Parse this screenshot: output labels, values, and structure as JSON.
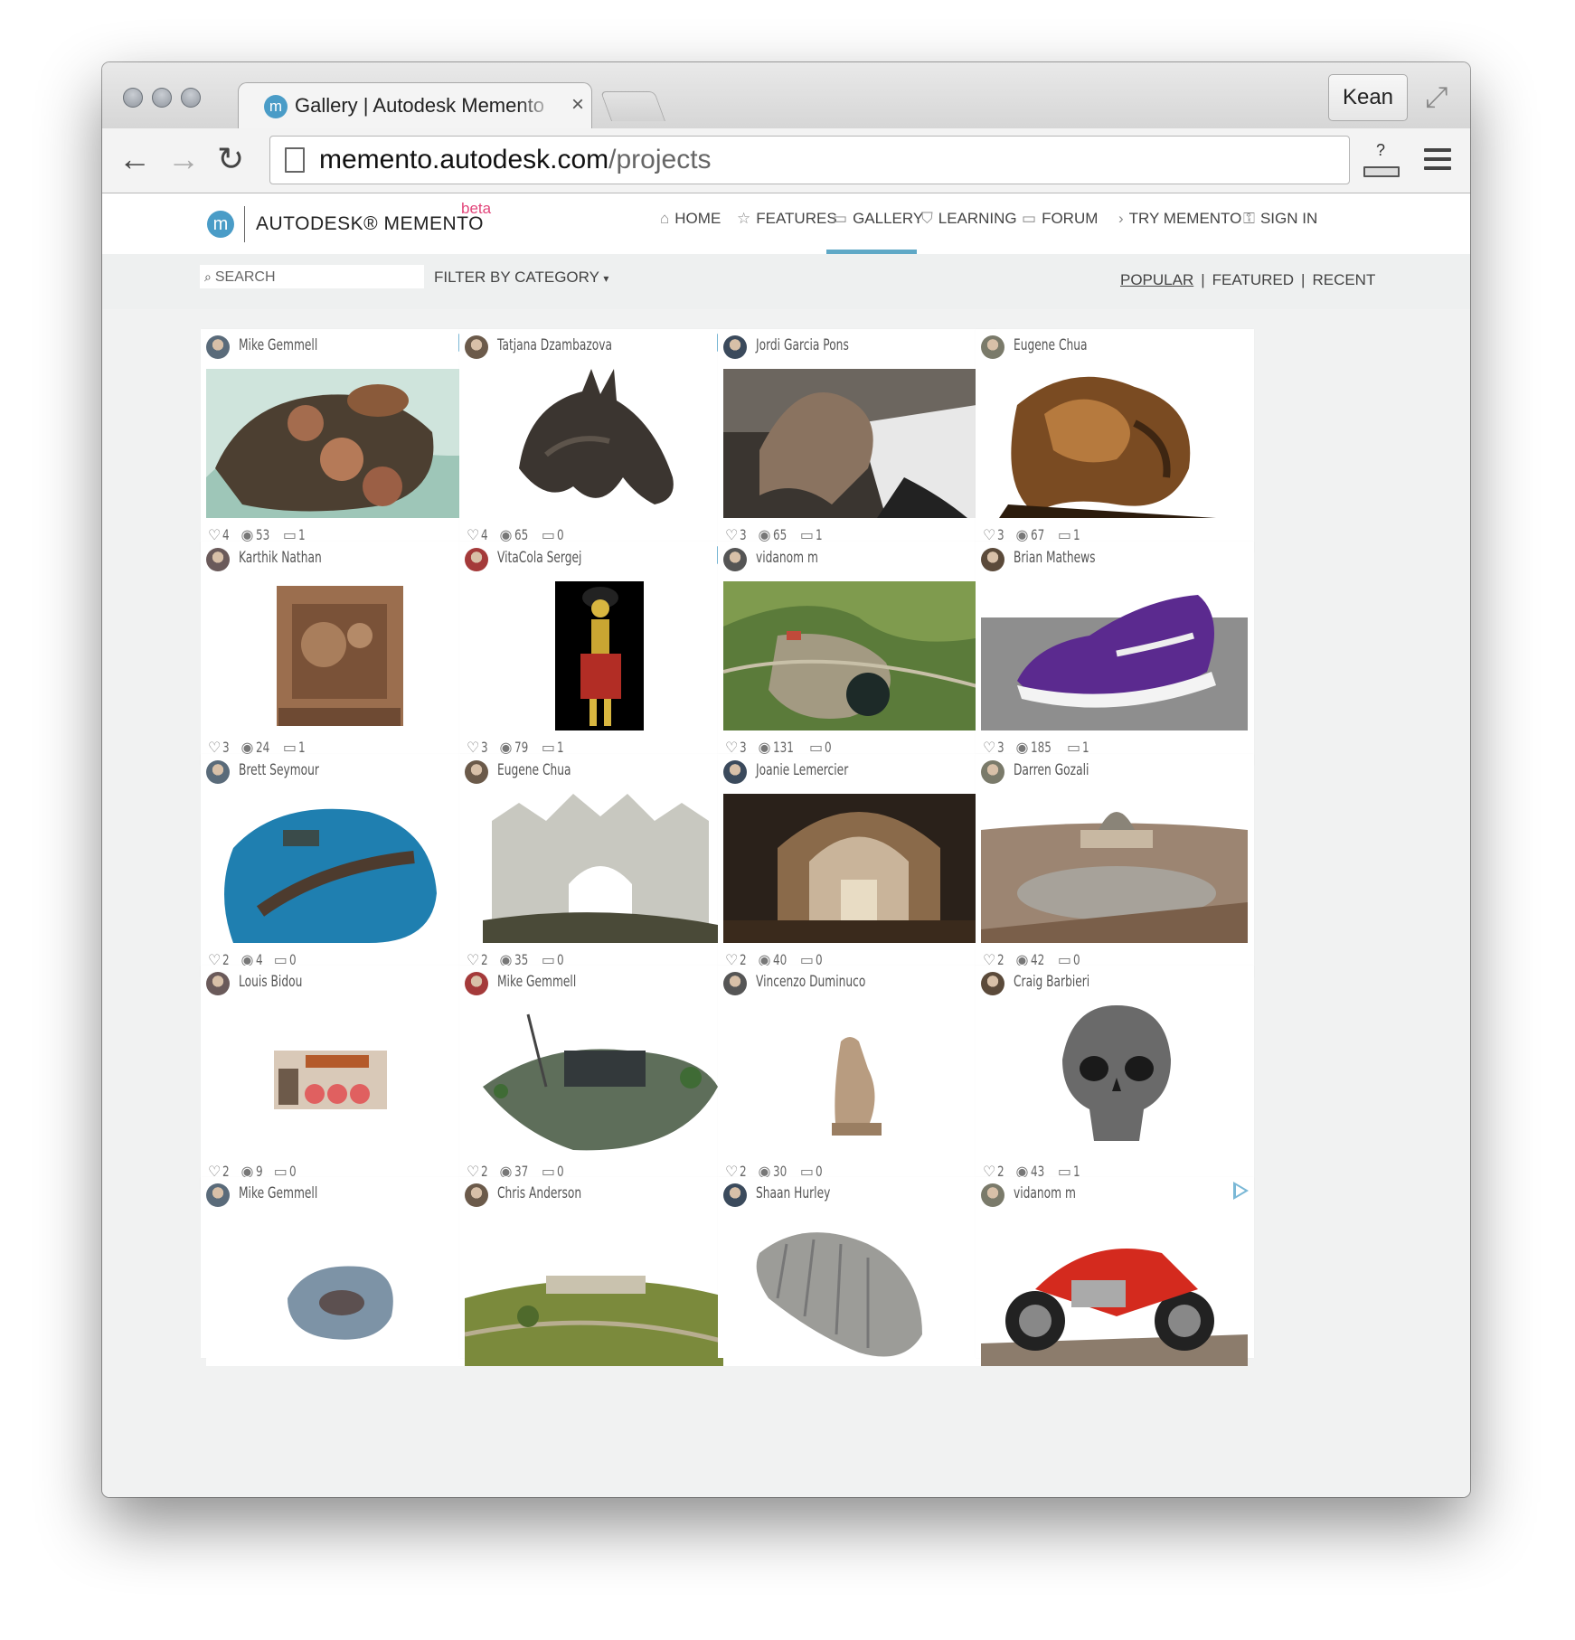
{
  "browser": {
    "tab_title": "Gallery | Autodesk Memento",
    "tab_close": "×",
    "user_button": "Kean",
    "url_host": "memento.autodesk.com",
    "url_path": "/projects",
    "ext_label": "?"
  },
  "site": {
    "brand": "AUTODESK® MEMENTO",
    "beta": "beta",
    "nav": [
      {
        "label": "HOME",
        "icon": "home-icon",
        "glyph": "⌂"
      },
      {
        "label": "FEATURES",
        "icon": "star-icon",
        "glyph": "☆"
      },
      {
        "label": "GALLERY",
        "icon": "gallery-icon",
        "glyph": "▭"
      },
      {
        "label": "LEARNING",
        "icon": "graduation-cap-icon",
        "glyph": "⛉"
      },
      {
        "label": "FORUM",
        "icon": "chat-icon",
        "glyph": "▭"
      },
      {
        "label": "TRY MEMENTO",
        "icon": "chevron-right-icon",
        "glyph": "›"
      },
      {
        "label": "SIGN IN",
        "icon": "key-icon",
        "glyph": "⚿"
      }
    ],
    "search_placeholder": "SEARCH",
    "filter_label": "FILTER BY CATEGORY",
    "sort": {
      "popular": "POPULAR",
      "featured": "FEATURED",
      "recent": "RECENT",
      "sep": "|"
    }
  },
  "colors": {
    "accent": "#5fa8c6",
    "beta": "#e2457a",
    "play": "#7ab8d6"
  },
  "cards": [
    {
      "author": "Mike Gemmell",
      "likes": 4,
      "views": 53,
      "comments": 1,
      "play": true,
      "thumb": "coral-rocks"
    },
    {
      "author": "Tatjana Dzambazova",
      "likes": 4,
      "views": 65,
      "comments": 0,
      "play": true,
      "thumb": "horse-head"
    },
    {
      "author": "Jordi Garcia Pons",
      "likes": 3,
      "views": 65,
      "comments": 1,
      "play": false,
      "thumb": "dog-sculpture"
    },
    {
      "author": "Eugene Chua",
      "likes": 3,
      "views": 67,
      "comments": 1,
      "play": false,
      "thumb": "wood-lion"
    },
    {
      "author": "Karthik Nathan",
      "likes": 3,
      "views": 24,
      "comments": 1,
      "play": false,
      "thumb": "stone-relief"
    },
    {
      "author": "VitaCola Sergej",
      "likes": 3,
      "views": 79,
      "comments": 1,
      "play": true,
      "thumb": "skeleton-figure"
    },
    {
      "author": "vidanom m",
      "likes": 3,
      "views": 131,
      "comments": 0,
      "play": true,
      "thumb": "aerial-quarry"
    },
    {
      "author": "Brian Mathews",
      "likes": 3,
      "views": 185,
      "comments": 1,
      "play": false,
      "thumb": "purple-sneaker"
    },
    {
      "author": "Brett Seymour",
      "likes": 2,
      "views": 4,
      "comments": 0,
      "play": false,
      "thumb": "underwater-wreck"
    },
    {
      "author": "Eugene Chua",
      "likes": 2,
      "views": 35,
      "comments": 0,
      "play": false,
      "thumb": "gothic-gate"
    },
    {
      "author": "Joanie Lemercier",
      "likes": 2,
      "views": 40,
      "comments": 0,
      "play": false,
      "thumb": "church-interior"
    },
    {
      "author": "Darren Gozali",
      "likes": 2,
      "views": 42,
      "comments": 0,
      "play": false,
      "thumb": "st-peters-square"
    },
    {
      "author": "Louis Bidou",
      "likes": 2,
      "views": 9,
      "comments": 0,
      "play": false,
      "thumb": "nyc-building"
    },
    {
      "author": "Mike Gemmell",
      "likes": 2,
      "views": 37,
      "comments": 0,
      "play": false,
      "thumb": "office-site"
    },
    {
      "author": "Vincenzo Duminuco",
      "likes": 2,
      "views": 30,
      "comments": 0,
      "play": false,
      "thumb": "seated-statue"
    },
    {
      "author": "Craig Barbieri",
      "likes": 2,
      "views": 43,
      "comments": 1,
      "play": false,
      "thumb": "skull"
    },
    {
      "author": "Mike Gemmell",
      "likes": null,
      "views": null,
      "comments": null,
      "play": false,
      "thumb": "rock-fossil"
    },
    {
      "author": "Chris Anderson",
      "likes": null,
      "views": null,
      "comments": null,
      "play": false,
      "thumb": "aerial-estate"
    },
    {
      "author": "Shaan Hurley",
      "likes": null,
      "views": null,
      "comments": null,
      "play": false,
      "thumb": "grey-larva"
    },
    {
      "author": "vidanom m",
      "likes": null,
      "views": null,
      "comments": null,
      "play": true,
      "thumb": "red-motorcycle"
    }
  ]
}
